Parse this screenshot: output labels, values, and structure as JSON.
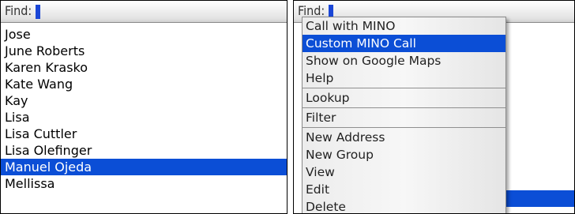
{
  "left_screen": {
    "find_label": "Find:",
    "contacts": [
      {
        "name": "Jose",
        "selected": false
      },
      {
        "name": "June Roberts",
        "selected": false
      },
      {
        "name": "Karen Krasko",
        "selected": false
      },
      {
        "name": "Kate Wang",
        "selected": false
      },
      {
        "name": "Kay",
        "selected": false
      },
      {
        "name": "Lisa",
        "selected": false
      },
      {
        "name": "Lisa Cuttler",
        "selected": false
      },
      {
        "name": "Lisa Olefinger",
        "selected": false
      },
      {
        "name": "Manuel Ojeda",
        "selected": true
      },
      {
        "name": "Mellissa",
        "selected": false
      }
    ]
  },
  "right_screen": {
    "find_label": "Find:",
    "menu": {
      "items": [
        {
          "label": "Call with MINO",
          "selected": false
        },
        {
          "label": "Custom MINO Call",
          "selected": true
        },
        {
          "label": "Show on Google Maps",
          "selected": false
        },
        {
          "label": "Help",
          "selected": false
        },
        {
          "separator": true
        },
        {
          "label": "Lookup",
          "selected": false
        },
        {
          "separator": true
        },
        {
          "label": "Filter",
          "selected": false
        },
        {
          "separator": true
        },
        {
          "label": "New Address",
          "selected": false
        },
        {
          "label": "New Group",
          "selected": false
        },
        {
          "label": "View",
          "selected": false
        },
        {
          "label": "Edit",
          "selected": false
        },
        {
          "label": "Delete",
          "selected": false
        }
      ]
    }
  },
  "colors": {
    "selection": "#0b4ed6",
    "cursor": "#1a46d6"
  }
}
